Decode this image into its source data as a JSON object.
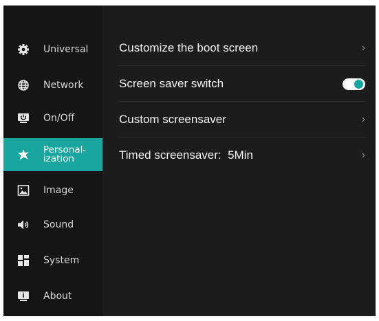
{
  "sidebar": {
    "items": [
      {
        "label": "Universal",
        "icon": "gear-icon"
      },
      {
        "label": "Network",
        "icon": "globe-icon"
      },
      {
        "label": "On/Off",
        "icon": "power-monitor-icon"
      },
      {
        "label": "Personal-\nization",
        "icon": "personalization-icon",
        "active": true
      },
      {
        "label": "Image",
        "icon": "image-icon"
      },
      {
        "label": "Sound",
        "icon": "speaker-icon"
      },
      {
        "label": "System",
        "icon": "system-grid-icon"
      },
      {
        "label": "About",
        "icon": "info-monitor-icon"
      }
    ]
  },
  "settings": {
    "boot_screen": "Customize the boot screen",
    "screen_saver_switch": "Screen saver switch",
    "screen_saver_switch_on": true,
    "custom_screensaver": "Custom screensaver",
    "timed_screensaver": "Timed screensaver:  5Min"
  },
  "colors": {
    "accent": "#1aa6a0",
    "background": "#1c1c1c",
    "sidebar": "#151515"
  }
}
